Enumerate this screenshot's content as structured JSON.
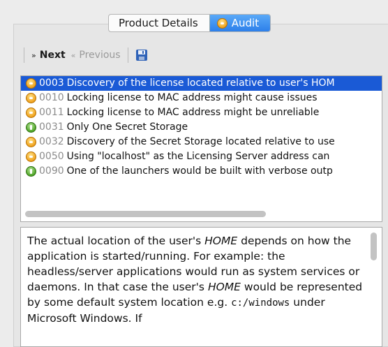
{
  "tabs": [
    {
      "label": "Product Details",
      "active": false
    },
    {
      "label": "Audit",
      "active": true,
      "icon": "warning-circle-icon"
    }
  ],
  "toolbar": {
    "next_label": "Next",
    "previous_label": "Previous",
    "save_icon": "floppy-disk-icon"
  },
  "issues": [
    {
      "code": "0003",
      "text": "Discovery of the license located relative to user's HOM",
      "icon": "warning",
      "selected": true
    },
    {
      "code": "0010",
      "text": "Locking license to MAC address might cause issues",
      "icon": "warning",
      "selected": false
    },
    {
      "code": "0011",
      "text": "Locking license to MAC address might be unreliable",
      "icon": "warning",
      "selected": false
    },
    {
      "code": "0031",
      "text": "Only One Secret Storage",
      "icon": "info",
      "selected": false
    },
    {
      "code": "0032",
      "text": "Discovery of the Secret Storage located relative to use",
      "icon": "warning",
      "selected": false
    },
    {
      "code": "0050",
      "text": "Using \"localhost\" as the Licensing Server address can",
      "icon": "warning",
      "selected": false
    },
    {
      "code": "0090",
      "text": "One of the launchers would be built with verbose outp",
      "icon": "info",
      "selected": false
    }
  ],
  "description": {
    "t1": "The actual location of the user's ",
    "home1": "HOME",
    "t2": " depends on how the application is started/running. For example: the headless/server applications would run as system services or daemons. In that case the user's ",
    "home2": "HOME",
    "t3": " would be represented by some default system location e.g. ",
    "path": "c:/windows",
    "t4": " under Microsoft Windows. If"
  },
  "colors": {
    "selection": "#1a5ad6",
    "active_tab": "#2d80ea",
    "warning": "#f0a21e",
    "ok": "#4fa527"
  }
}
